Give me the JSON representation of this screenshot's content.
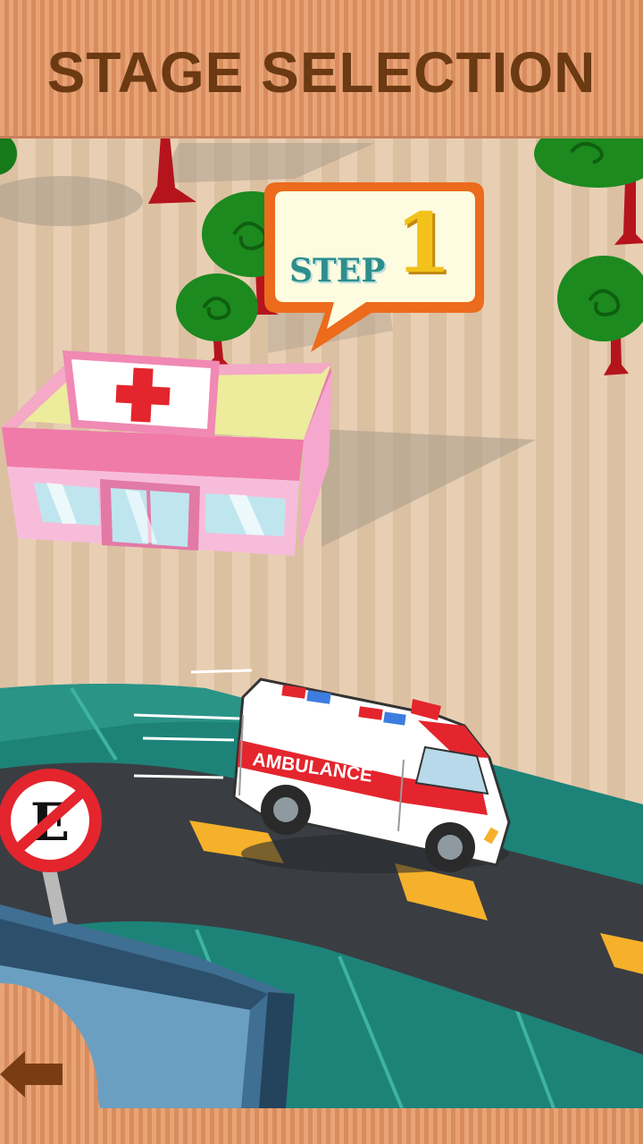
{
  "header": {
    "title": "STAGE SELECTION"
  },
  "stage": {
    "step_label": "STEP",
    "step_number": "1"
  },
  "ambulance": {
    "label": "AMBULANCE"
  },
  "sign": {
    "letter": "E"
  },
  "colors": {
    "header_bg": "#e49a6c",
    "title_text": "#6b3a12",
    "bubble_border": "#ec6b1c",
    "step_text": "#2e8e8c",
    "step_number": "#f2c21b",
    "road": "#3a3d42",
    "grass": "#2a8f83",
    "hospital_pink": "#f59ac5",
    "ambulance_red": "#e4252d"
  },
  "icons": {
    "back": "left-arrow-icon"
  }
}
